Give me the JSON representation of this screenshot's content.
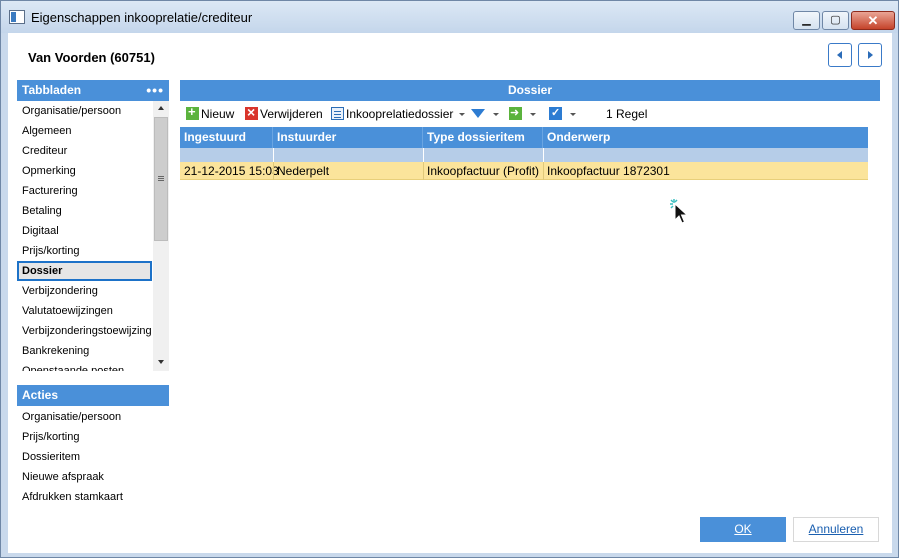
{
  "window": {
    "title": "Eigenschappen inkooprelatie/crediteur",
    "minimize": "▁",
    "maximize": "▢",
    "close": "✕"
  },
  "header": {
    "record_title": "Van Voorden (60751)",
    "prev_icon": "chevron-left-icon",
    "next_icon": "chevron-right-icon"
  },
  "tabs_panel": {
    "title": "Tabbladen",
    "menu": "•••",
    "items": [
      {
        "label": "Organisatie/persoon",
        "selected": false
      },
      {
        "label": "Algemeen",
        "selected": false
      },
      {
        "label": "Crediteur",
        "selected": false
      },
      {
        "label": "Opmerking",
        "selected": false
      },
      {
        "label": "Facturering",
        "selected": false
      },
      {
        "label": "Betaling",
        "selected": false
      },
      {
        "label": "Digitaal",
        "selected": false
      },
      {
        "label": "Prijs/korting",
        "selected": false
      },
      {
        "label": "Dossier",
        "selected": true
      },
      {
        "label": "Verbijzondering",
        "selected": false
      },
      {
        "label": "Valutatoewijzingen",
        "selected": false
      },
      {
        "label": "Verbijzonderingstoewijzingen",
        "selected": false
      },
      {
        "label": "Bankrekening",
        "selected": false
      },
      {
        "label": "Openstaande posten",
        "selected": false
      }
    ]
  },
  "actions_panel": {
    "title": "Acties",
    "items": [
      "Organisatie/persoon",
      "Prijs/korting",
      "Dossieritem",
      "Nieuwe afspraak",
      "Afdrukken stamkaart"
    ]
  },
  "dossier": {
    "title": "Dossier",
    "toolbar": {
      "new_label": "Nieuw",
      "delete_label": "Verwijderen",
      "dossier_label": "Inkooprelatiedossier",
      "row_count": "1 Regel"
    },
    "columns": [
      "Ingestuurd",
      "Instuurder",
      "Type dossieritem",
      "Onderwerp"
    ],
    "rows": [
      [
        "21-12-2015 15:03",
        "Nederpelt",
        "Inkoopfactuur (Profit)",
        "Inkoopfactuur 1872301"
      ]
    ]
  },
  "footer": {
    "ok_label": "OK",
    "cancel_label": "Annuleren"
  },
  "colors": {
    "accent": "#4a90d9",
    "selected_row": "#fbe49b",
    "filter_row": "#b6cde8"
  }
}
